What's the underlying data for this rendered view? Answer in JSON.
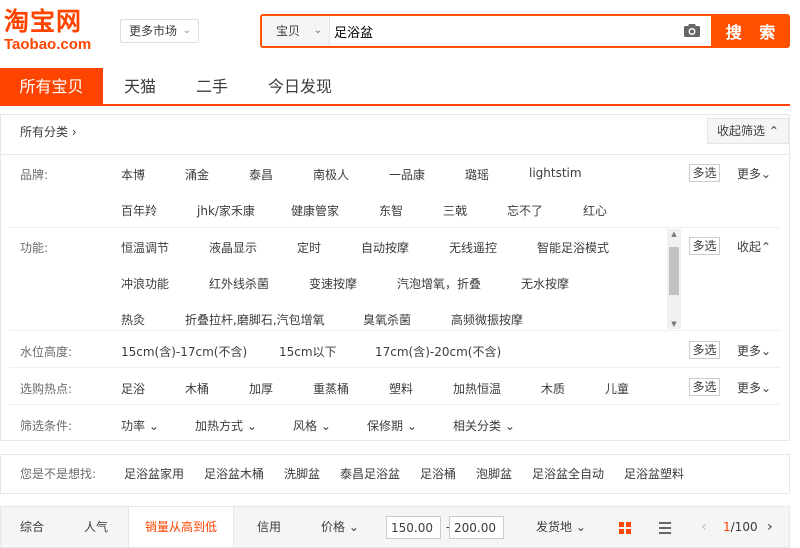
{
  "header": {
    "logo_cn": "淘宝网",
    "logo_en": "Taobao.com",
    "market_label": "更多市场",
    "search_type": "宝贝",
    "search_value": "足浴盆",
    "search_button": "搜 索"
  },
  "tabs": [
    {
      "label": "所有宝贝",
      "active": true
    },
    {
      "label": "天猫",
      "active": false
    },
    {
      "label": "二手",
      "active": false
    },
    {
      "label": "今日发现",
      "active": false
    }
  ],
  "category": {
    "all_label": "所有分类",
    "collapse_label": "收起筛选"
  },
  "filters": {
    "brand": {
      "label": "品牌:",
      "row1": [
        "本博",
        "涌金",
        "泰昌",
        "南极人",
        "一品康",
        "璐瑶",
        "lightstim"
      ],
      "row2": [
        "百年羚",
        "jhk/家禾康",
        "健康管家",
        "东智",
        "三戟",
        "忘不了",
        "红心"
      ],
      "multi": "多选",
      "more": "更多"
    },
    "function": {
      "label": "功能:",
      "row1": [
        "恒温调节",
        "液晶显示",
        "定时",
        "自动按摩",
        "无线遥控",
        "智能足浴模式"
      ],
      "row2": [
        "冲浪功能",
        "红外线杀菌",
        "变速按摩",
        "汽泡增氧，折叠",
        "无水按摩"
      ],
      "row3": [
        "热灸",
        "折叠拉杆,磨脚石,汽包增氧",
        "臭氧杀菌",
        "高频微振按摩"
      ],
      "multi": "多选",
      "collapse": "收起"
    },
    "water": {
      "label": "水位高度:",
      "items": [
        "15cm(含)-17cm(不含)",
        "15cm以下",
        "17cm(含)-20cm(不含)"
      ],
      "multi": "多选",
      "more": "更多"
    },
    "hot": {
      "label": "选购热点:",
      "items": [
        "足浴",
        "木桶",
        "加厚",
        "重蒸桶",
        "塑料",
        "加热恒温",
        "木质",
        "儿童"
      ],
      "multi": "多选",
      "more": "更多"
    },
    "conditions": {
      "label": "筛选条件:",
      "items": [
        "功率",
        "加热方式",
        "风格",
        "保修期",
        "相关分类"
      ]
    }
  },
  "related": {
    "label": "您是不是想找:",
    "items": [
      "足浴盆家用",
      "足浴盆木桶",
      "洗脚盆",
      "泰昌足浴盆",
      "足浴桶",
      "泡脚盆",
      "足浴盆全自动",
      "足浴盆塑料"
    ]
  },
  "sortbar": {
    "items": [
      {
        "label": "综合",
        "active": false
      },
      {
        "label": "人气",
        "active": false
      },
      {
        "label": "销量从高到低",
        "active": true
      },
      {
        "label": "信用",
        "active": false
      },
      {
        "label": "价格",
        "active": false
      }
    ],
    "price_min": "150.00",
    "price_max": "200.00",
    "price_dash": "-",
    "location": "发货地",
    "page_current": "1",
    "page_total": "/100"
  },
  "colors": {
    "accent": "#ff4400",
    "search_border": "#ff5000"
  }
}
